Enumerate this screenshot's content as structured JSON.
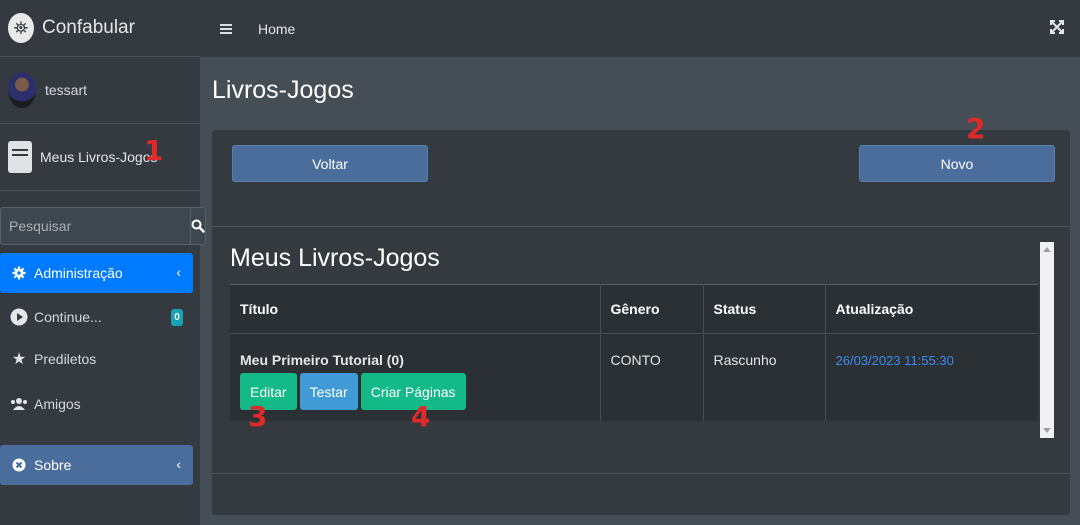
{
  "brand": {
    "name": "Confabular",
    "icon": "lighthouse-logo-icon"
  },
  "user": {
    "name": "tessart"
  },
  "books_panel": {
    "label": "Meus Livros-Jogos",
    "icon": "book-icon"
  },
  "search": {
    "placeholder": "Pesquisar",
    "value": ""
  },
  "nav": {
    "admin": "Administração",
    "continue": "Continue...",
    "continue_badge": "0",
    "favorites": "Prediletos",
    "friends": "Amigos",
    "about": "Sobre"
  },
  "topbar": {
    "home": "Home"
  },
  "page": {
    "title": "Livros-Jogos",
    "back_button": "Voltar",
    "new_button": "Novo",
    "section_title": "Meus Livros-Jogos"
  },
  "table": {
    "headers": [
      "Título",
      "Gênero",
      "Status",
      "Atualização"
    ],
    "rows": [
      {
        "title": "Meu Primeiro Tutorial (0)",
        "genre": "CONTO",
        "status": "Rascunho",
        "updated": "26/03/2023 11:55:30",
        "actions": [
          "Editar",
          "Testar",
          "Criar Páginas"
        ]
      }
    ]
  },
  "annotations": [
    "1",
    "2",
    "3",
    "4"
  ],
  "colors": {
    "sidebar": "#343a40",
    "active": "#007bff",
    "primary_button": "#4a6d9b",
    "green_button": "#13b987",
    "blue_button": "#3f9ad6",
    "annotation": "#e02a2a",
    "link": "#3b8cf0"
  }
}
